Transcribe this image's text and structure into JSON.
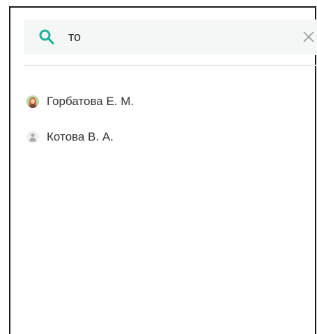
{
  "search": {
    "value": "то",
    "accent_color": "#20b39b",
    "search_icon": "search-icon",
    "clear_icon": "close-icon"
  },
  "results": [
    {
      "name": "Горбатова Е. М.",
      "avatar": "user-photo-avatar"
    },
    {
      "name": "Котова В. А.",
      "avatar": "user-placeholder-avatar"
    }
  ]
}
